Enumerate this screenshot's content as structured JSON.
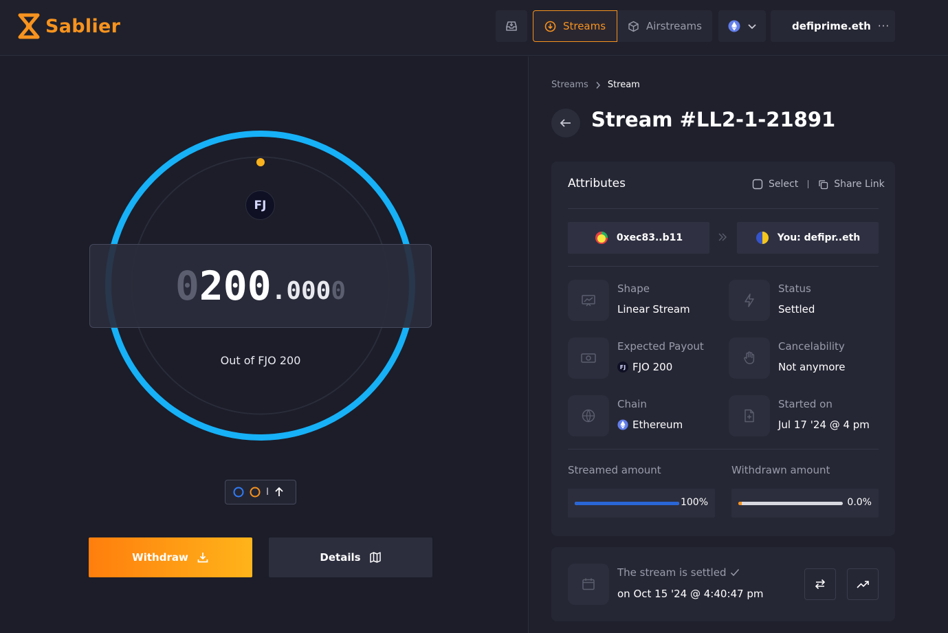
{
  "app": {
    "name": "Sablier"
  },
  "topbar": {
    "streams_label": "Streams",
    "airstreams_label": "Airstreams",
    "account_name": "defiprime.eth",
    "more_label": "···"
  },
  "colors": {
    "accent": "#f7931e",
    "ring": "#18b0f5",
    "streamed_bar": "#2966d6",
    "withdrawn_bar": "#f7931e"
  },
  "stream_visual": {
    "amount_leading_dim": "0",
    "amount_integer": "200",
    "amount_dot": ".",
    "amount_decimals": "000",
    "amount_trailing_dim": "0",
    "out_of": "Out of FJO 200",
    "token_logo_text": "FJ",
    "legend_separator": "I"
  },
  "actions": {
    "withdraw_label": "Withdraw",
    "details_label": "Details"
  },
  "breadcrumb": {
    "parent": "Streams",
    "current": "Stream"
  },
  "page": {
    "title": "Stream #LL2-1-21891"
  },
  "attributes": {
    "title": "Attributes",
    "select_label": "Select",
    "share_label": "Share Link",
    "sender": "0xec83..b11",
    "recipient": "You: defipr..eth",
    "items": [
      {
        "label": "Shape",
        "value": "Linear Stream",
        "icon": "chart-icon"
      },
      {
        "label": "Status",
        "value": "Settled",
        "icon": "lightning-icon"
      },
      {
        "label": "Expected Payout",
        "value": "FJO 200",
        "icon": "cash-icon"
      },
      {
        "label": "Cancelability",
        "value": "Not anymore",
        "icon": "hand-icon"
      },
      {
        "label": "Chain",
        "value": "Ethereum",
        "icon": "globe-icon"
      },
      {
        "label": "Started on",
        "value": "Jul 17 '24 @ 4 pm",
        "icon": "file-plus-icon"
      }
    ],
    "streamed_label": "Streamed amount",
    "streamed_pct": "100%",
    "streamed_fraction": 1.0,
    "withdrawn_label": "Withdrawn amount",
    "withdrawn_pct": "0.0%",
    "withdrawn_fraction": 0.0
  },
  "settlement": {
    "line1": "The stream is settled",
    "line2": "on Oct 15 '24 @ 4:40:47 pm"
  }
}
